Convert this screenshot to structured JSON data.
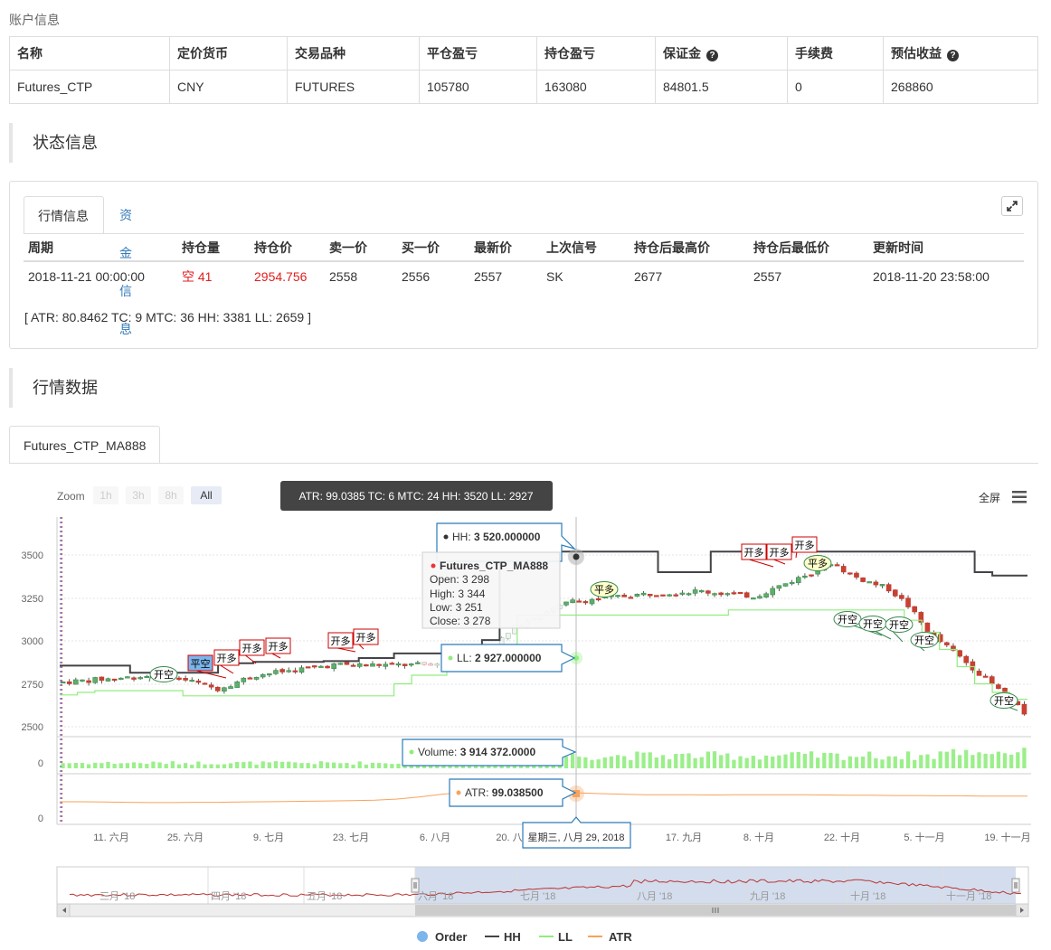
{
  "account": {
    "title": "账户信息",
    "headers": [
      "名称",
      "定价货币",
      "交易品种",
      "平仓盈亏",
      "持仓盈亏",
      "保证金",
      "手续费",
      "预估收益"
    ],
    "row": [
      "Futures_CTP",
      "CNY",
      "FUTURES",
      "105780",
      "163080",
      "84801.5",
      "0",
      "268860"
    ]
  },
  "status": {
    "title": "状态信息",
    "tabs": [
      "行情信息",
      "资金信息"
    ],
    "headers": [
      "周期",
      "持仓量",
      "持仓价",
      "卖一价",
      "买一价",
      "最新价",
      "上次信号",
      "持仓后最高价",
      "持仓后最低价",
      "更新时间"
    ],
    "row": [
      "2018-11-21 00:00:00",
      "空 41",
      "2954.756",
      "2558",
      "2556",
      "2557",
      "SK",
      "2677",
      "2557",
      "2018-11-20 23:58:00"
    ],
    "info_line": "[ ATR: 80.8462 TC: 9 MTC: 36 HH: 3381 LL: 2659 ]"
  },
  "market": {
    "title": "行情数据",
    "chart_tab": "Futures_CTP_MA888"
  },
  "chart_ui": {
    "zoom_label": "Zoom",
    "zoom_buttons": [
      "1h",
      "3h",
      "8h",
      "All"
    ],
    "fullscreen_label": "全屏",
    "title_text": "ATR: 99.0385 TC: 6 MTC: 24 HH: 3520 LL: 2927",
    "tooltip_hh": "HH: ",
    "tooltip_hh_value": "3 520.000000",
    "tooltip_ll": "LL: ",
    "tooltip_ll_value": "2 927.000000",
    "tooltip_ohlc_title": "Futures_CTP_MA888",
    "tooltip_ohlc": [
      "Open: 3 298",
      "High: 3 344",
      "Low: 3 251",
      "Close: 3 278"
    ],
    "tooltip_volume": "Volume: ",
    "tooltip_volume_value": "3 914 372.0000",
    "tooltip_atr": "ATR: ",
    "tooltip_atr_value": "99.038500",
    "x_crosshair_label": "星期三, 八月 29, 2018",
    "y_ticks_price": [
      "3500",
      "3250",
      "3000",
      "2750",
      "2500"
    ],
    "y_tick_volume": "0",
    "y_tick_atr": "0",
    "x_ticks": [
      "11. 六月",
      "25. 六月",
      "9. 七月",
      "23. 七月",
      "6. 八月",
      "20. 八",
      "17. 九月",
      "8. 十月",
      "22. 十月",
      "5. 十一月",
      "19. 十一月"
    ],
    "navigator_labels": [
      "三月 '18",
      "四月 '18",
      "五月 '18",
      "六月 '18",
      "七月 '18",
      "八月 '18",
      "九月 '18",
      "十月 '18",
      "十一月 '18"
    ],
    "legend": [
      "Order",
      "HH",
      "LL",
      "ATR"
    ],
    "flags": {
      "kai_duo": "开多",
      "ping_duo": "平多",
      "kai_kong": "开空",
      "ping_kong": "平空"
    }
  },
  "chart_data": {
    "type": "candlestick",
    "series": [
      {
        "name": "HH",
        "values": [
          2856,
          2856,
          2856,
          2856,
          2814,
          2814,
          2814,
          2814,
          2814,
          2870,
          2870,
          2878,
          2878,
          2878,
          2878,
          2882,
          2882,
          2900,
          2900,
          2927,
          2927,
          2927,
          2927,
          2963,
          3005,
          3520,
          3520,
          3520,
          3520,
          3520,
          3520,
          3520,
          3520,
          3520,
          3400,
          3400,
          3400,
          3520,
          3520,
          3520,
          3520,
          3520,
          3520,
          3520,
          3520,
          3520,
          3520,
          3520,
          3520,
          3520,
          3520,
          3520,
          3400,
          3380,
          3380
        ]
      },
      {
        "name": "LL",
        "values": [
          2685,
          2700,
          2710,
          2710,
          2710,
          2710,
          2710,
          2680,
          2680,
          2680,
          2680,
          2680,
          2680,
          2680,
          2680,
          2680,
          2680,
          2680,
          2680,
          2750,
          2800,
          2800,
          2830,
          2830,
          2865,
          2927,
          3150,
          3150,
          3150,
          3150,
          3150,
          3150,
          3150,
          3150,
          3150,
          3150,
          3150,
          3150,
          3180,
          3180,
          3180,
          3180,
          3180,
          3180,
          3180,
          3180,
          3180,
          3180,
          3120,
          3050,
          2950,
          2850,
          2750,
          2700,
          2660
        ]
      },
      {
        "name": "ATR",
        "values": [
          60,
          60,
          59,
          58,
          57,
          57,
          58,
          58,
          59,
          60,
          61,
          62,
          63,
          64,
          66,
          70,
          78,
          88,
          95,
          99,
          100,
          99,
          97,
          93,
          90,
          88,
          86,
          86,
          86,
          85,
          86,
          86,
          86,
          86,
          85,
          84,
          84,
          83,
          83,
          82,
          82,
          81,
          81,
          81
        ]
      },
      {
        "name": "Volume",
        "values": [
          3.9
        ]
      }
    ],
    "ohlc_highlight": {
      "date": "星期三, 八月 29, 2018",
      "open": 3298,
      "high": 3344,
      "low": 3251,
      "close": 3278
    },
    "ylim": [
      2450,
      3600
    ]
  }
}
